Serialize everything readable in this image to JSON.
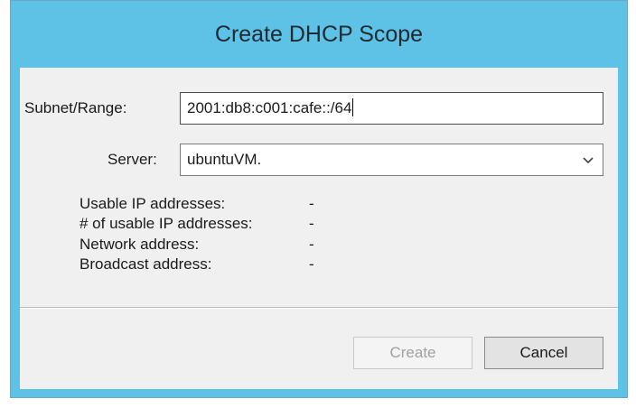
{
  "dialog": {
    "title": "Create DHCP Scope"
  },
  "form": {
    "subnet_label": "Subnet/Range:",
    "subnet_value": "2001:db8:c001:cafe::/64",
    "server_label": "Server:",
    "server_value": "ubuntuVM."
  },
  "info": {
    "usable_ip_label": "Usable IP addresses:",
    "usable_ip_value": "-",
    "usable_count_label": "# of usable IP addresses:",
    "usable_count_value": "-",
    "network_label": "Network address:",
    "network_value": "-",
    "broadcast_label": "Broadcast address:",
    "broadcast_value": "-"
  },
  "buttons": {
    "create_label": "Create",
    "cancel_label": "Cancel"
  },
  "colors": {
    "title_bar": "#5ec2e6",
    "client_bg": "#f0f0f0",
    "disabled_text": "#a0a0a0"
  },
  "icons": {
    "server_dropdown": "chevron-down-icon"
  }
}
